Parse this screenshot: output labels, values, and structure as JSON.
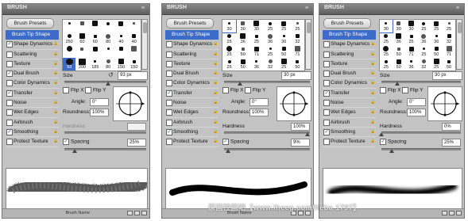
{
  "panels": [
    {
      "title": "BRUSH",
      "presets_label": "Brush Presets",
      "options": [
        {
          "label": "Brush Tip Shape",
          "checked": null,
          "selected": true,
          "lock": false
        },
        {
          "label": "Shape Dynamics",
          "checked": true,
          "selected": false,
          "lock": true
        },
        {
          "label": "Scattering",
          "checked": false,
          "selected": false,
          "lock": true
        },
        {
          "label": "Texture",
          "checked": false,
          "selected": false,
          "lock": true
        },
        {
          "label": "Dual Brush",
          "checked": true,
          "selected": false,
          "lock": true
        },
        {
          "label": "Color Dynamics",
          "checked": false,
          "selected": false,
          "lock": true
        },
        {
          "label": "Transfer",
          "checked": true,
          "selected": false,
          "lock": true
        },
        {
          "label": "Noise",
          "checked": false,
          "selected": false,
          "lock": true
        },
        {
          "label": "Wet Edges",
          "checked": false,
          "selected": false,
          "lock": true
        },
        {
          "label": "Airbrush",
          "checked": false,
          "selected": false,
          "lock": true
        },
        {
          "label": "Smoothing",
          "checked": true,
          "selected": false,
          "lock": true
        },
        {
          "label": "Protect Texture",
          "checked": false,
          "selected": false,
          "lock": true
        }
      ],
      "brush_grid": [
        "",
        "",
        "",
        "",
        "",
        "",
        "250",
        "60",
        "60",
        "80",
        "40",
        "40",
        "",
        "",
        "",
        "",
        "",
        "",
        "93",
        "200",
        "185",
        "80",
        "150",
        "150"
      ],
      "size_label": "Size",
      "size_value": "93 px",
      "flip_x": "Flip X",
      "flip_y": "Flip Y",
      "angle_label": "Angle:",
      "angle_value": "0°",
      "roundness_label": "Roundness:",
      "roundness_value": "100%",
      "hardness_label": "Hardness",
      "hardness_value": "",
      "spacing_label": "Spacing",
      "spacing_value": "25%",
      "bottom_label": "Brush Name"
    },
    {
      "title": "BRUSH",
      "presets_label": "Brush Presets",
      "options": [
        {
          "label": "Brush Tip Shape",
          "checked": null,
          "selected": true,
          "lock": false
        },
        {
          "label": "Shape Dynamics",
          "checked": false,
          "selected": false,
          "lock": true
        },
        {
          "label": "Scattering",
          "checked": false,
          "selected": false,
          "lock": true
        },
        {
          "label": "Texture",
          "checked": false,
          "selected": false,
          "lock": true
        },
        {
          "label": "Dual Brush",
          "checked": false,
          "selected": false,
          "lock": true
        },
        {
          "label": "Color Dynamics",
          "checked": false,
          "selected": false,
          "lock": true
        },
        {
          "label": "Transfer",
          "checked": true,
          "selected": false,
          "lock": true
        },
        {
          "label": "Noise",
          "checked": false,
          "selected": false,
          "lock": true
        },
        {
          "label": "Wet Edges",
          "checked": false,
          "selected": false,
          "lock": true
        },
        {
          "label": "Airbrush",
          "checked": false,
          "selected": false,
          "lock": true
        },
        {
          "label": "Smoothing",
          "checked": true,
          "selected": false,
          "lock": true
        },
        {
          "label": "Protect Texture",
          "checked": false,
          "selected": false,
          "lock": true
        }
      ],
      "brush_grid": [
        "30",
        "30",
        "30",
        "25",
        "25",
        "25",
        "25",
        "36",
        "25",
        "36",
        "36",
        "32",
        "25",
        "50",
        "71",
        "25",
        "50",
        "71",
        "25",
        "50",
        "36",
        "32",
        "25",
        "50"
      ],
      "size_label": "Size",
      "size_value": "30 px",
      "flip_x": "Flip X",
      "flip_y": "Flip Y",
      "angle_label": "Angle:",
      "angle_value": "0°",
      "roundness_label": "Roundness:",
      "roundness_value": "100%",
      "hardness_label": "Hardness",
      "hardness_value": "100%",
      "spacing_label": "Spacing",
      "spacing_value": "9%",
      "bottom_label": "Brush Name"
    },
    {
      "title": "BRUSH",
      "presets_label": "Brush Presets",
      "options": [
        {
          "label": "Brush Tip Shape",
          "checked": null,
          "selected": true,
          "lock": false
        },
        {
          "label": "Shape Dynamics",
          "checked": false,
          "selected": false,
          "lock": true
        },
        {
          "label": "Scattering",
          "checked": false,
          "selected": false,
          "lock": true
        },
        {
          "label": "Texture",
          "checked": false,
          "selected": false,
          "lock": true
        },
        {
          "label": "Dual Brush",
          "checked": false,
          "selected": false,
          "lock": true
        },
        {
          "label": "Color Dynamics",
          "checked": false,
          "selected": false,
          "lock": true
        },
        {
          "label": "Transfer",
          "checked": true,
          "selected": false,
          "lock": true
        },
        {
          "label": "Noise",
          "checked": false,
          "selected": false,
          "lock": true
        },
        {
          "label": "Wet Edges",
          "checked": false,
          "selected": false,
          "lock": true
        },
        {
          "label": "Airbrush",
          "checked": false,
          "selected": false,
          "lock": true
        },
        {
          "label": "Smoothing",
          "checked": true,
          "selected": false,
          "lock": true
        },
        {
          "label": "Protect Texture",
          "checked": false,
          "selected": false,
          "lock": true
        }
      ],
      "brush_grid": [
        "30",
        "30",
        "30",
        "25",
        "25",
        "25",
        "25",
        "36",
        "25",
        "36",
        "36",
        "32",
        "25",
        "50",
        "71",
        "25",
        "50",
        "71",
        "25",
        "50",
        "36",
        "32",
        "25",
        "50"
      ],
      "size_label": "Size",
      "size_value": "30 px",
      "flip_x": "Flip X",
      "flip_y": "Flip Y",
      "angle_label": "Angle:",
      "angle_value": "0°",
      "roundness_label": "Roundness:",
      "roundness_value": "100%",
      "hardness_label": "Hardness",
      "hardness_value": "0%",
      "spacing_label": "Spacing",
      "spacing_value": "25%",
      "bottom_label": ""
    }
  ],
  "watermark": "原画控画吧【www.lheeg.com/lieba 1797】",
  "colors": {
    "accent": "#3d6bc9",
    "panel_bg": "#c3c3c3",
    "titlebar": "#6b6b6b"
  }
}
